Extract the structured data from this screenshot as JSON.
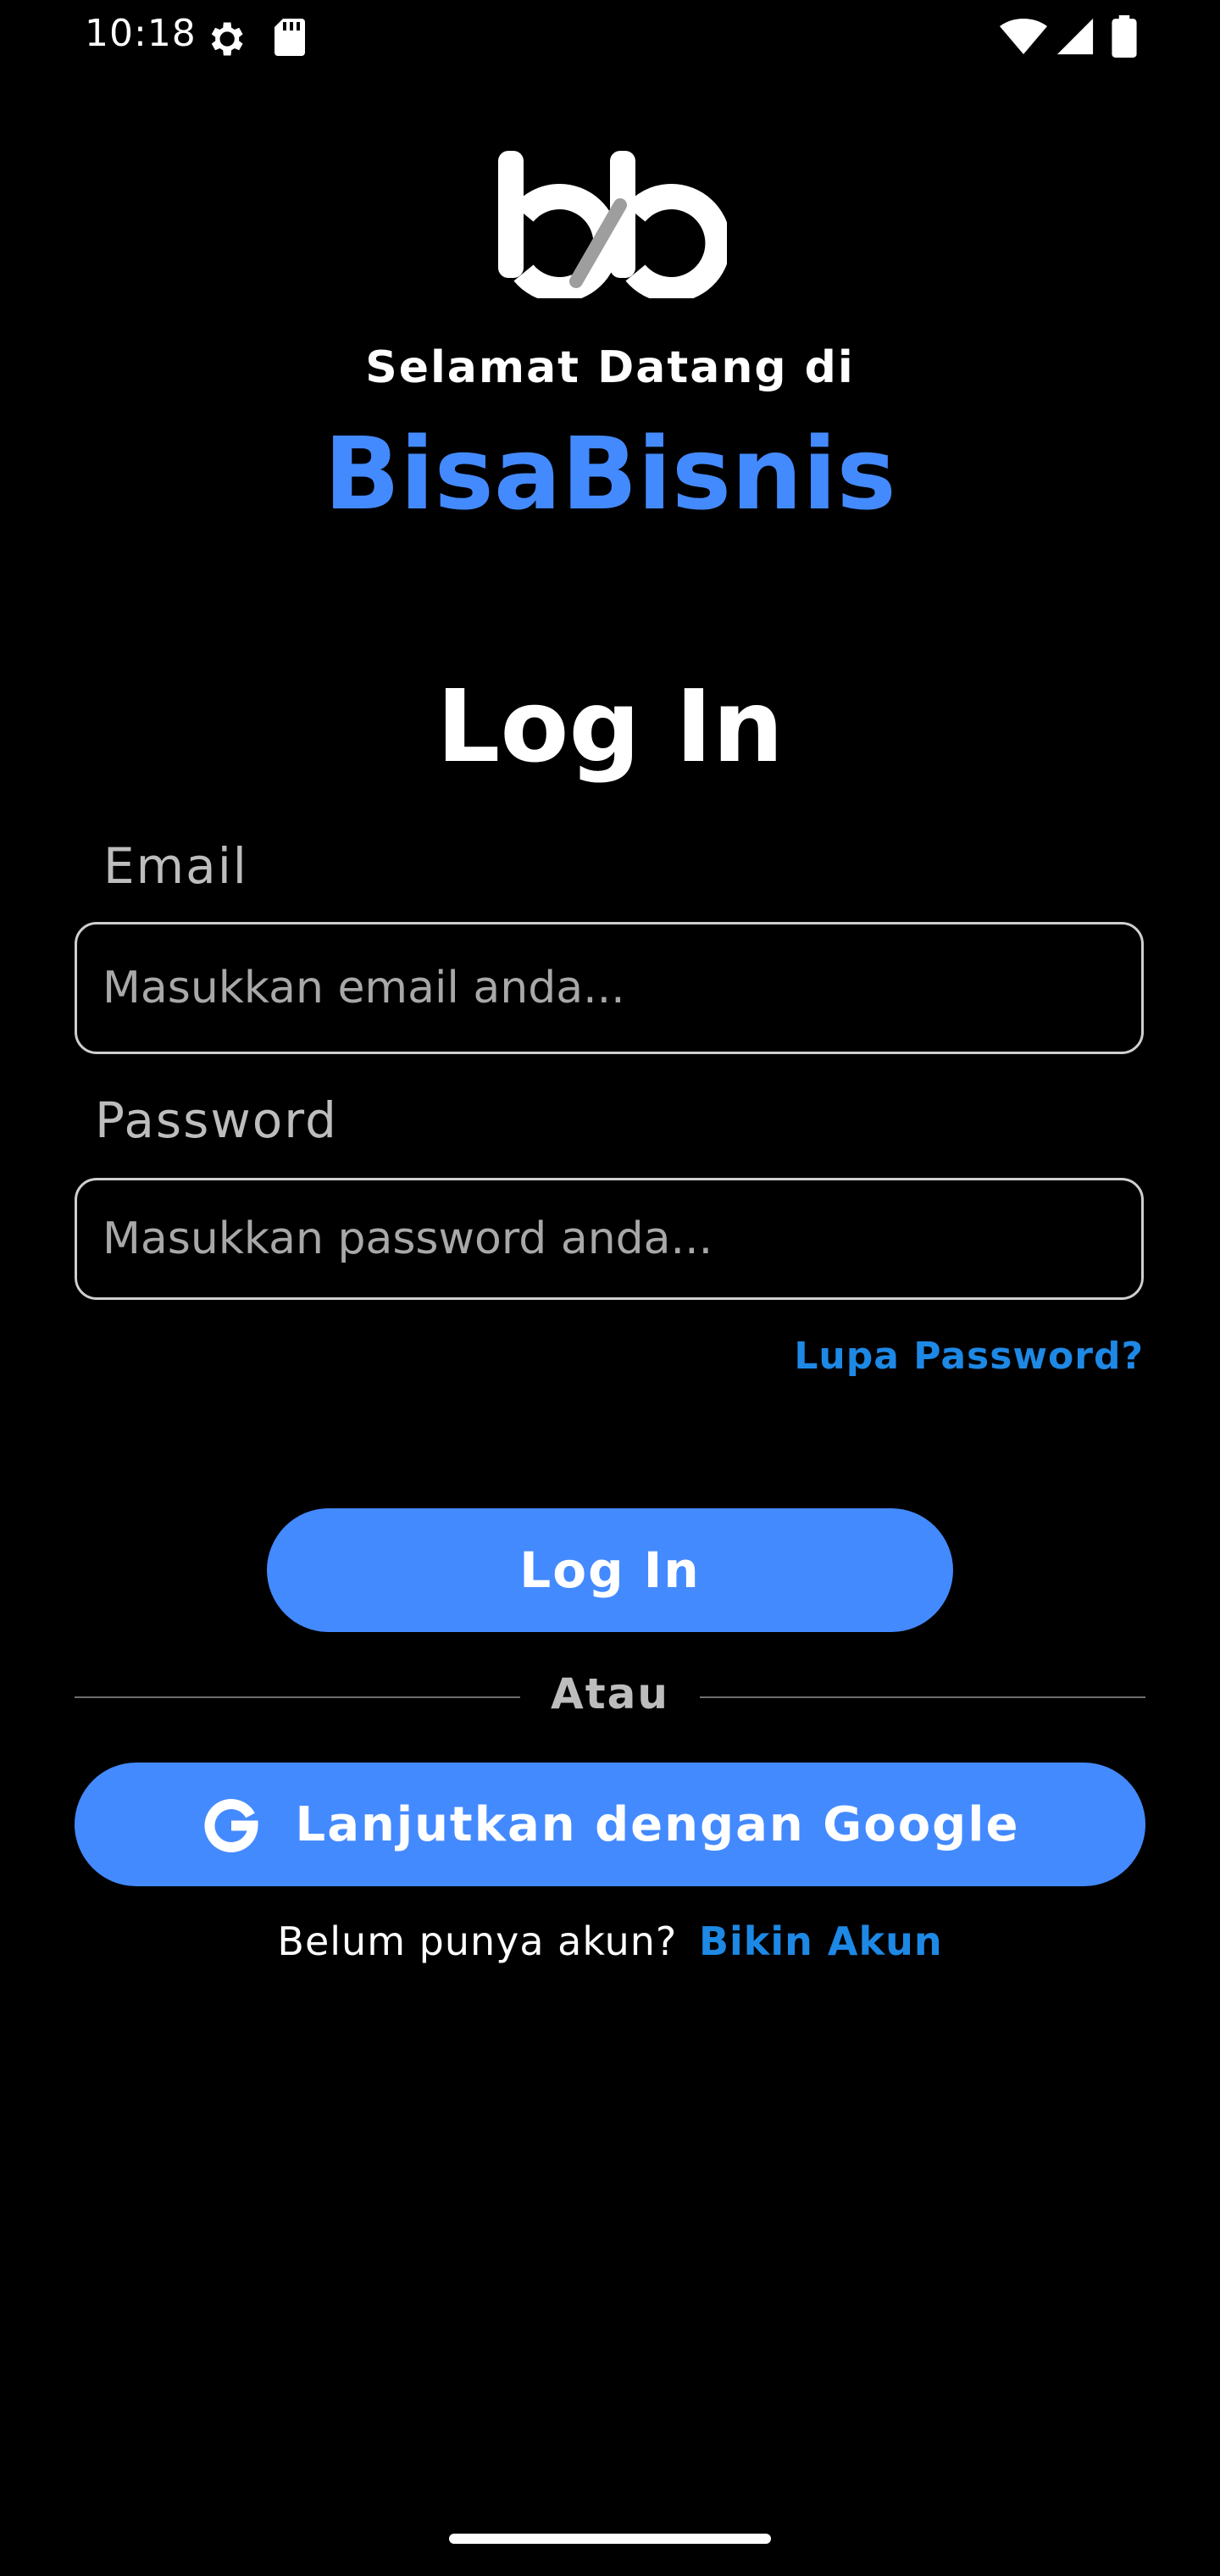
{
  "status_bar": {
    "time": "10:18",
    "icons": [
      "settings-icon",
      "sd-card-icon",
      "wifi-icon",
      "signal-icon",
      "battery-icon"
    ]
  },
  "header": {
    "logo_icon": "bb-logo-icon",
    "welcome": "Selamat Datang di",
    "brand": "BisaBisnis"
  },
  "form": {
    "heading": "Log In",
    "email_label": "Email",
    "email_placeholder": "Masukkan email anda...",
    "password_label": "Password",
    "password_placeholder": "Masukkan password anda...",
    "forgot_label": "Lupa Password?",
    "login_button": "Log In",
    "divider_text": "Atau",
    "google_button": "Lanjutkan dengan Google",
    "google_icon": "google-g-icon",
    "signup_prompt": "Belum punya akun?",
    "signup_link": "Bikin Akun"
  },
  "colors": {
    "background": "#000000",
    "accent": "#448aff",
    "link": "#1e88e5",
    "text": "#ffffff",
    "muted": "#bdbdbd"
  }
}
